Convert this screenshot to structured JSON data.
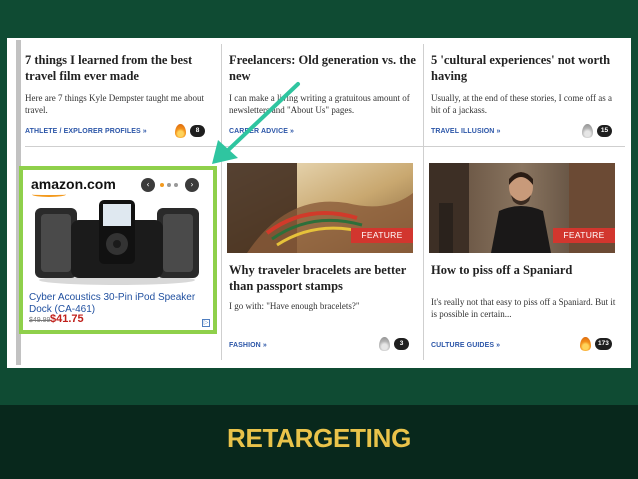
{
  "articles_top": [
    {
      "title": "7 things I learned from the best travel film ever made",
      "description": "Here are 7 things Kyle Dempster taught me about travel.",
      "category": "ATHLETE / EXPLORER PROFILES »",
      "comments": "8",
      "hot": true
    },
    {
      "title": "Freelancers: Old generation vs. the new",
      "description": "I can make a living writing a gratuitous amount of newsletters and \"About Us\" pages.",
      "category": "CAREER ADVICE »",
      "comments": "",
      "hot": false
    },
    {
      "title": "5 'cultural experiences' not worth having",
      "description": "Usually, at the end of these stories, I come off as a bit of a jackass.",
      "category": "TRAVEL ILLUSION »",
      "comments": "15",
      "hot": false
    }
  ],
  "articles_bottom": [
    {
      "badge": "FEATURE",
      "title": "Why traveler bracelets are better than passport stamps",
      "description": "I go with: \"Have enough bracelets?\"",
      "category": "FASHION »",
      "comments": "3",
      "hot": false
    },
    {
      "badge": "FEATURE",
      "title": "How to piss off a Spaniard",
      "description": "It's really not that easy to piss off a Spaniard. But it is possible in certain...",
      "category": "CULTURE GUIDES »",
      "comments": "173",
      "hot": true
    }
  ],
  "ad": {
    "brand": "amazon.com",
    "product_title": "Cyber Acoustics 30-Pin iPod Speaker Dock (CA-461)",
    "old_price": "$49.99",
    "price": "$41.75",
    "carousel_prev": "‹",
    "carousel_next": "›"
  },
  "slide": {
    "title": "RETARGETING"
  },
  "colors": {
    "background": "#0f4b33",
    "ad_highlight": "#8fd04b",
    "arrow": "#2fc5a0",
    "title_text": "#e9c34a",
    "link": "#2c56a8",
    "feature_badge": "#d2362e"
  }
}
